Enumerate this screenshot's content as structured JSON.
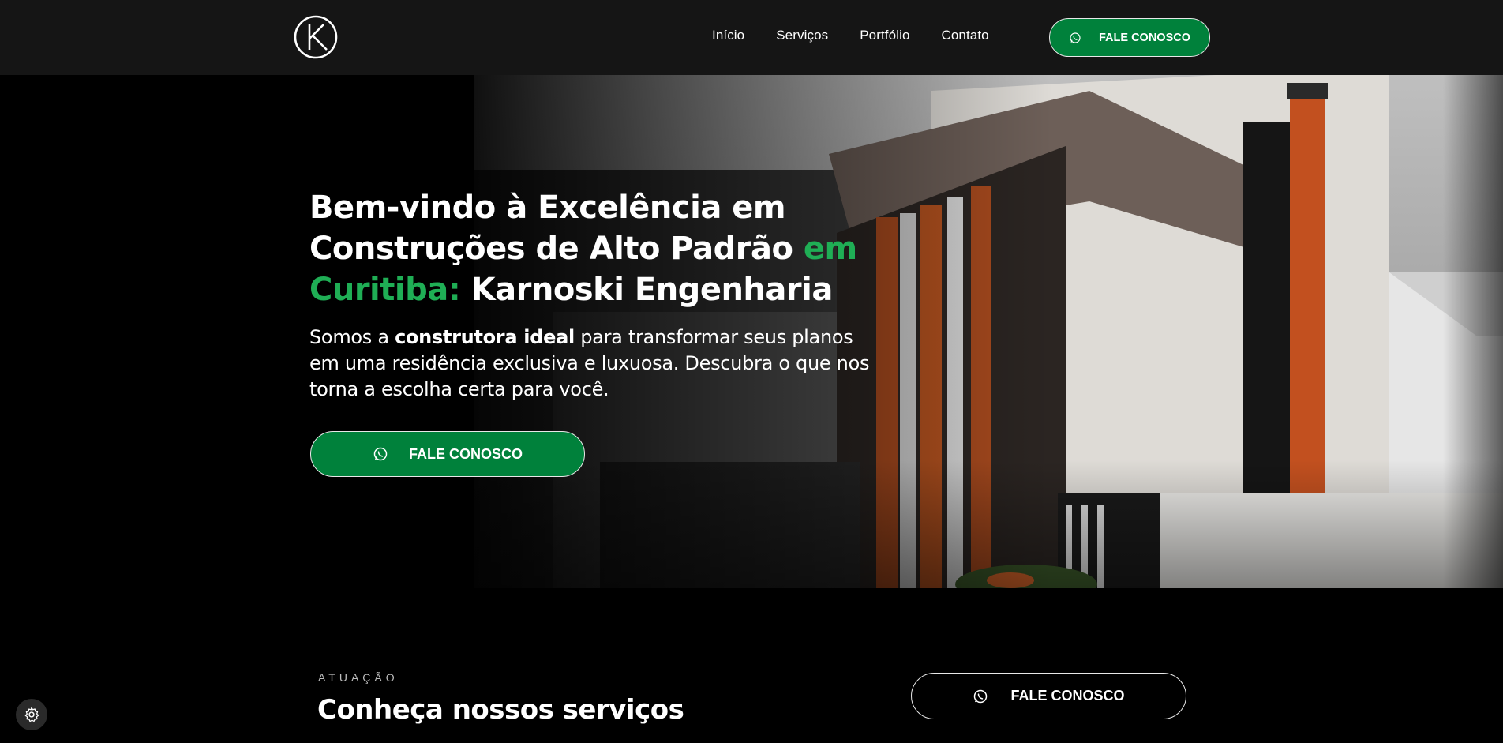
{
  "header": {
    "logo_icon": "k-monogram-logo",
    "nav": [
      {
        "label": "Início"
      },
      {
        "label": "Serviços"
      },
      {
        "label": "Portfólio"
      },
      {
        "label": "Contato"
      }
    ],
    "cta_label": "FALE CONOSCO",
    "cta_icon": "whatsapp-icon"
  },
  "hero": {
    "title_part1": "Bem-vindo à Excelência em Construções de Alto Padrão ",
    "title_accent": "em Curitiba:",
    "title_part2": " Karnoski Engenharia",
    "text_part1": "Somos a ",
    "text_bold": "construtora ideal",
    "text_part2": " para transformar seus planos em uma residência exclusiva e luxuosa. Descubra o que nos torna a escolha certa para você.",
    "cta_label": "FALE CONOSCO",
    "image_icon": "modern-house-photo"
  },
  "services": {
    "eyebrow": "ATUAÇÃO",
    "title": "Conheça nossos serviços",
    "cta_label": "FALE CONOSCO"
  },
  "settings_icon": "gear-icon",
  "colors": {
    "accent_green": "#1fae55",
    "button_green": "#00813b",
    "header_bg": "#151515",
    "page_bg": "#000000"
  }
}
